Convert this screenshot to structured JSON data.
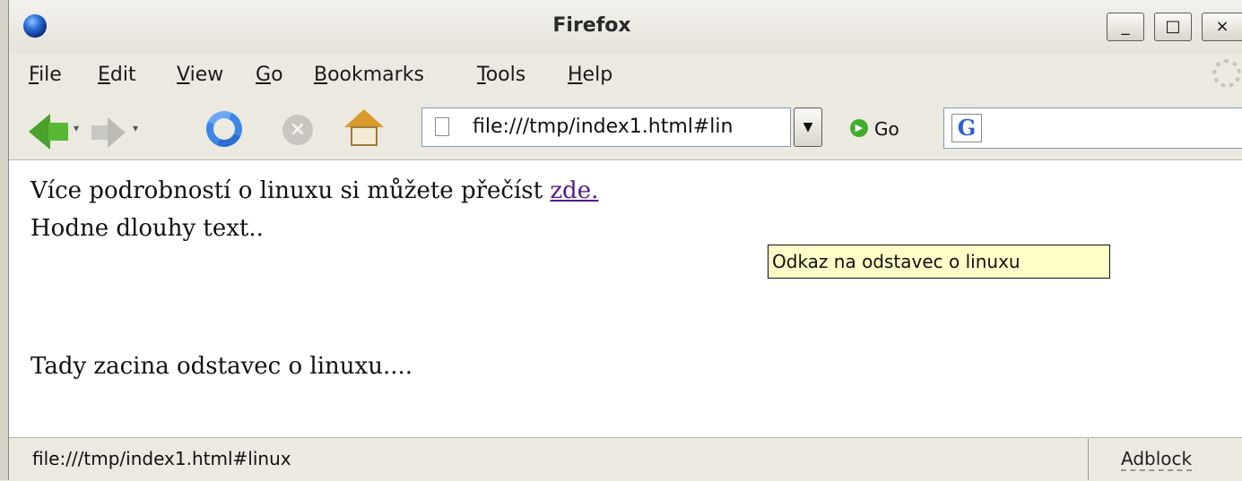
{
  "window": {
    "title": "Firefox",
    "buttons": {
      "minimize": "_",
      "maximize": "□",
      "close": "×"
    }
  },
  "menu": {
    "items": [
      {
        "label": "File",
        "mnemonic": "F",
        "rest": "ile"
      },
      {
        "label": "Edit",
        "mnemonic": "E",
        "rest": "dit"
      },
      {
        "label": "View",
        "mnemonic": "V",
        "rest": "iew"
      },
      {
        "label": "Go",
        "mnemonic": "G",
        "rest": "o"
      },
      {
        "label": "Bookmarks",
        "mnemonic": "B",
        "rest": "ookmarks"
      },
      {
        "label": "Tools",
        "mnemonic": "T",
        "rest": "ools"
      },
      {
        "label": "Help",
        "mnemonic": "H",
        "rest": "elp"
      }
    ]
  },
  "toolbar": {
    "url": "file:///tmp/index1.html#lin",
    "go_label": "Go",
    "search_engine_icon": "google-g",
    "search_value": ""
  },
  "content": {
    "line1_text": "Více podrobností o linuxu si můžete přečíst ",
    "link_text": "zde.",
    "line2_text": "Hodne dlouhy text..",
    "line3_text": "Tady zacina odstavec o linuxu....",
    "tooltip": "Odkaz na odstavec o linuxu"
  },
  "status": {
    "text": "file:///tmp/index1.html#linux",
    "adblock": "Adblock"
  },
  "colors": {
    "link_visited": "#551a8b",
    "tooltip_bg": "#ffffc8",
    "chrome_bg": "#ece9e1"
  }
}
